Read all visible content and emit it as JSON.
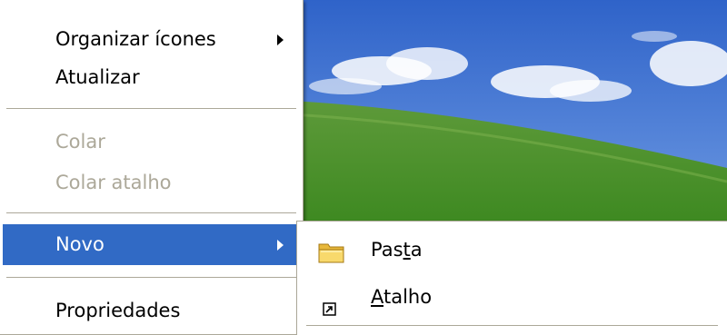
{
  "context_menu": {
    "items": [
      {
        "label": "Organizar ícones",
        "has_submenu": true,
        "enabled": true
      },
      {
        "label": "Atualizar",
        "enabled": true
      },
      {
        "label": "Colar",
        "enabled": false
      },
      {
        "label": "Colar atalho",
        "enabled": false
      },
      {
        "label": "Novo",
        "has_submenu": true,
        "enabled": true,
        "highlighted": true
      },
      {
        "label": "Propriedades",
        "enabled": true
      }
    ]
  },
  "submenu_novo": {
    "items": [
      {
        "label_pre": "Pas",
        "label_access": "t",
        "label_post": "a",
        "icon": "folder-icon"
      },
      {
        "label_pre": "",
        "label_access": "A",
        "label_post": "talho",
        "icon": "shortcut-icon"
      }
    ]
  },
  "colors": {
    "highlight": "#316ac5",
    "disabled_text": "#aca899",
    "separator": "#aca899"
  }
}
